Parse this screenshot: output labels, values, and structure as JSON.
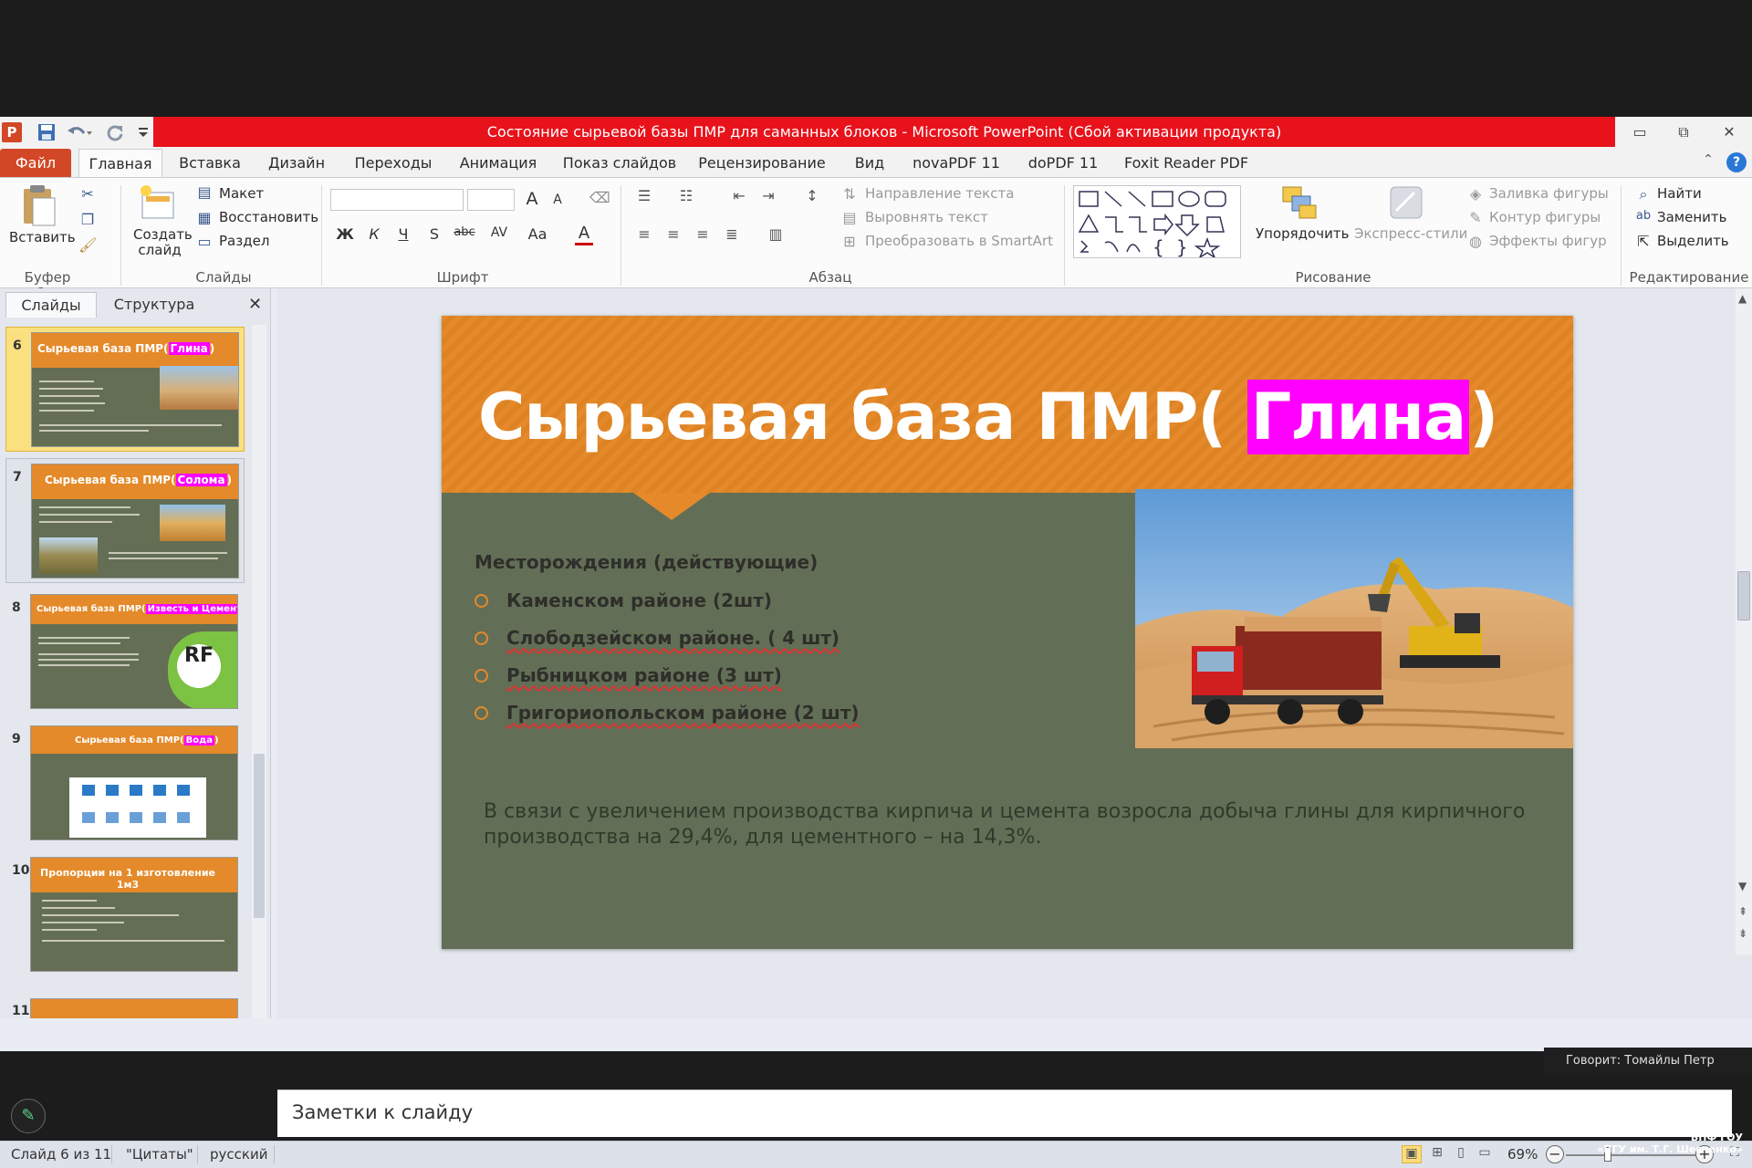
{
  "window": {
    "title": "Состояние сырьевой базы ПМР для саманных блоков  -  Microsoft PowerPoint (Сбой активации продукта)",
    "app_icon": "P",
    "controls": {
      "minimize": "▭",
      "restore": "⧉",
      "close": "✕"
    }
  },
  "tabs": [
    {
      "label": "Файл"
    },
    {
      "label": "Главная"
    },
    {
      "label": "Вставка"
    },
    {
      "label": "Дизайн"
    },
    {
      "label": "Переходы"
    },
    {
      "label": "Анимация"
    },
    {
      "label": "Показ слайдов"
    },
    {
      "label": "Рецензирование"
    },
    {
      "label": "Вид"
    },
    {
      "label": "novaPDF 11"
    },
    {
      "label": "doPDF 11"
    },
    {
      "label": "Foxit Reader PDF"
    }
  ],
  "help_glyph": "?",
  "ribbon": {
    "clipboard": {
      "paste": "Вставить",
      "label": "Буфер обм..."
    },
    "slides": {
      "new_slide": "Создать слайд",
      "layout": "Макет",
      "reset": "Восстановить",
      "section": "Раздел",
      "label": "Слайды"
    },
    "font": {
      "label": "Шрифт",
      "bold": "Ж",
      "italic": "К",
      "underline": "Ч",
      "shadow": "S",
      "strike": "abc",
      "spacing": "AV",
      "case": "Aa",
      "color": "A",
      "grow": "A",
      "shrink": "A"
    },
    "paragraph": {
      "label": "Абзац",
      "text_direction": "Направление текста",
      "align_text": "Выровнять текст",
      "smartart": "Преобразовать в SmartArt"
    },
    "drawing": {
      "label": "Рисование",
      "arrange": "Упорядочить",
      "quick_styles": "Экспресс-стили",
      "fill": "Заливка фигуры",
      "outline": "Контур фигуры",
      "effects": "Эффекты фигур"
    },
    "editing": {
      "label": "Редактирование",
      "find": "Найти",
      "replace": "Заменить",
      "select": "Выделить"
    }
  },
  "left_pane": {
    "tabs": [
      {
        "label": "Слайды"
      },
      {
        "label": "Структура"
      }
    ],
    "close": "✕",
    "thumbnails": [
      {
        "num": "6",
        "title": "Сырьевая база ПМР(",
        "highlight": "Глина",
        "end": ")"
      },
      {
        "num": "7",
        "title": "Сырьевая база ПМР(",
        "highlight": "Солома",
        "end": ")"
      },
      {
        "num": "8",
        "title": "Сырьевая база ПМР(",
        "highlight": "Известь и Цемент",
        "end": ")"
      },
      {
        "num": "9",
        "title": "Сырьевая база ПМР(",
        "highlight": "Вода",
        "end": ")"
      },
      {
        "num": "10",
        "title": "Пропорции  на 1 изготовление 1м3",
        "highlight": "",
        "end": ""
      }
    ],
    "partial_num": "11"
  },
  "slide": {
    "title_prefix": "Сырьевая база ПМР(",
    "title_highlight": "Глина",
    "title_suffix": ")",
    "heading": "Месторождения (действующие)",
    "bullets": [
      "Каменском районе (2шт)",
      "Слободзейском районе. ( 4 шт)",
      "Рыбницком районе  (3 шт)",
      "Григориопольском районе (2 шт)"
    ],
    "body": "В связи с увеличением производства кирпича и цемента возросла добыча глины для кирпичного производства на 29,4%, для цементного – на 14,3%."
  },
  "notes": {
    "placeholder": "Заметки к слайду"
  },
  "status": {
    "slide_info": "Слайд 6 из 11",
    "theme": "\"Цитаты\"",
    "language": "русский",
    "zoom": "69%",
    "zoom_minus": "−",
    "zoom_plus": "+"
  },
  "overlay": {
    "speaker": "Говорит: Томайлы Петр",
    "watermark_line1": "БПФ ГОУ",
    "watermark_line2": "«ПГУ им. Т.Г. Шевченко»"
  }
}
